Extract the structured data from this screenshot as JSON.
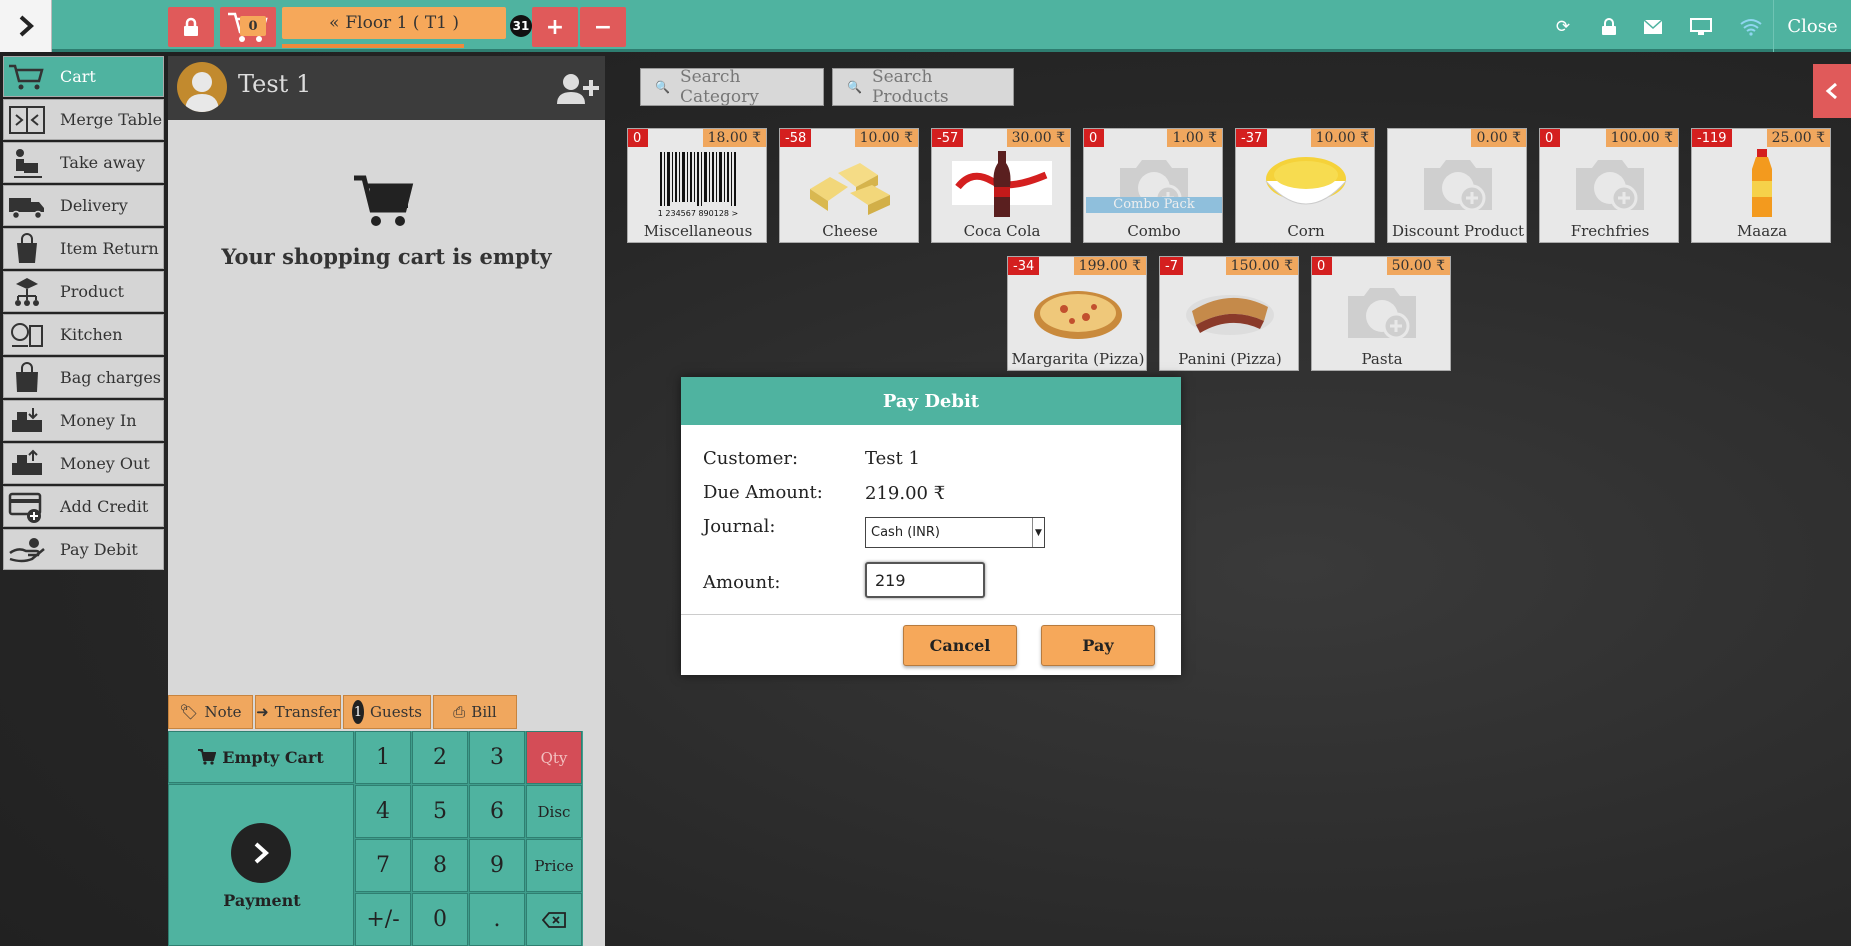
{
  "topbar": {
    "cart_count": "0",
    "floor_label": "Floor 1 ( T1 )",
    "floor_badge": "31",
    "close_label": "Close"
  },
  "sidebar": {
    "items": [
      {
        "label": "Cart",
        "icon": "cart-icon"
      },
      {
        "label": "Merge Table",
        "icon": "merge-table-icon"
      },
      {
        "label": "Take away",
        "icon": "take-away-icon"
      },
      {
        "label": "Delivery",
        "icon": "delivery-truck-icon"
      },
      {
        "label": "Item Return",
        "icon": "item-return-icon"
      },
      {
        "label": "Product",
        "icon": "product-icon"
      },
      {
        "label": "Kitchen",
        "icon": "kitchen-icon"
      },
      {
        "label": "Bag charges",
        "icon": "bag-icon"
      },
      {
        "label": "Money In",
        "icon": "money-in-icon"
      },
      {
        "label": "Money Out",
        "icon": "money-out-icon"
      },
      {
        "label": "Add Credit",
        "icon": "add-credit-icon"
      },
      {
        "label": "Pay Debit",
        "icon": "pay-debit-icon"
      }
    ]
  },
  "cart": {
    "customer_name": "Test 1",
    "empty_message": "Your shopping cart is empty",
    "actions": {
      "note": "Note",
      "transfer": "Transfer",
      "guests_count": "1",
      "guests": "Guests",
      "bill": "Bill"
    },
    "empty_cart_label": "Empty Cart",
    "payment_label": "Payment",
    "keys": {
      "k1": "1",
      "k2": "2",
      "k3": "3",
      "qty": "Qty",
      "k4": "4",
      "k5": "5",
      "k6": "6",
      "disc": "Disc",
      "k7": "7",
      "k8": "8",
      "k9": "9",
      "price": "Price",
      "sign": "+/-",
      "k0": "0",
      "dot": "."
    }
  },
  "search": {
    "category": "Search Category",
    "products": "Search Products"
  },
  "products": [
    {
      "name": "Miscellaneous",
      "stock": "0",
      "price": "18.00 ₹"
    },
    {
      "name": "Cheese",
      "stock": "-58",
      "price": "10.00 ₹"
    },
    {
      "name": "Coca Cola",
      "stock": "-57",
      "price": "30.00 ₹"
    },
    {
      "name": "Combo",
      "stock": "0",
      "price": "1.00 ₹",
      "tag": "Combo Pack"
    },
    {
      "name": "Corn",
      "stock": "-37",
      "price": "10.00 ₹"
    },
    {
      "name": "Discount Product",
      "stock": "",
      "price": "0.00 ₹"
    },
    {
      "name": "Frechfries",
      "stock": "0",
      "price": "100.00 ₹"
    },
    {
      "name": "Maaza",
      "stock": "-119",
      "price": "25.00 ₹"
    },
    {
      "name": "Margarita (Pizza)",
      "stock": "-34",
      "price": "199.00 ₹"
    },
    {
      "name": "Panini (Pizza)",
      "stock": "-7",
      "price": "150.00 ₹"
    },
    {
      "name": "Pasta",
      "stock": "0",
      "price": "50.00 ₹"
    }
  ],
  "modal": {
    "title": "Pay Debit",
    "customer_label": "Customer:",
    "customer_value": "Test 1",
    "due_label": "Due Amount:",
    "due_value": "219.00 ₹",
    "journal_label": "Journal:",
    "journal_value": "Cash (INR)",
    "amount_label": "Amount:",
    "amount_value": "219",
    "cancel": "Cancel",
    "pay": "Pay"
  },
  "colors": {
    "teal": "#4fb3a0",
    "orange": "#f6a85a",
    "red": "#e05a5a"
  }
}
